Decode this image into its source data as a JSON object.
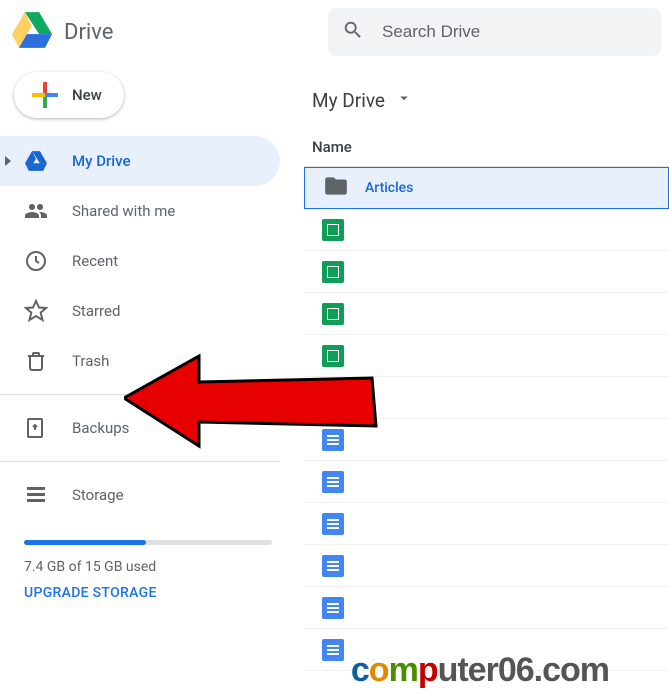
{
  "header": {
    "title": "Drive",
    "search_placeholder": "Search Drive"
  },
  "sidebar": {
    "new_label": "New",
    "items": [
      {
        "id": "my-drive",
        "label": "My Drive",
        "icon": "drive-logo-icon",
        "active": true
      },
      {
        "id": "shared",
        "label": "Shared with me",
        "icon": "people-icon"
      },
      {
        "id": "recent",
        "label": "Recent",
        "icon": "clock-icon"
      },
      {
        "id": "starred",
        "label": "Starred",
        "icon": "star-icon"
      },
      {
        "id": "trash",
        "label": "Trash",
        "icon": "trash-icon"
      }
    ],
    "secondary": [
      {
        "id": "backups",
        "label": "Backups",
        "icon": "backups-icon"
      }
    ],
    "storage": {
      "label": "Storage",
      "used_text": "7.4 GB of 15 GB used",
      "upgrade_label": "UPGRADE STORAGE",
      "fill_percent": 49
    }
  },
  "content": {
    "breadcrumb": "My Drive",
    "column_header": "Name",
    "files": [
      {
        "type": "folder",
        "name": "Articles",
        "selected": true
      },
      {
        "type": "sheets",
        "name": ""
      },
      {
        "type": "sheets",
        "name": ""
      },
      {
        "type": "sheets",
        "name": ""
      },
      {
        "type": "sheets",
        "name": ""
      },
      {
        "type": "drawings",
        "name": ""
      },
      {
        "type": "docs",
        "name": ""
      },
      {
        "type": "docs",
        "name": ""
      },
      {
        "type": "docs",
        "name": ""
      },
      {
        "type": "docs",
        "name": ""
      },
      {
        "type": "docs",
        "name": ""
      },
      {
        "type": "docs",
        "name": ""
      }
    ]
  },
  "watermark": "computer06.com"
}
